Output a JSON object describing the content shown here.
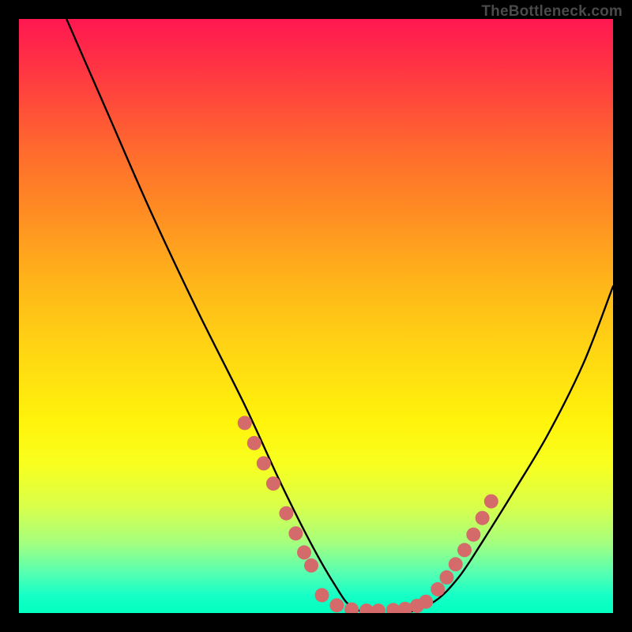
{
  "watermark": "TheBottleneck.com",
  "chart_data": {
    "type": "line",
    "title": "",
    "xlabel": "",
    "ylabel": "",
    "xlim": [
      0,
      100
    ],
    "ylim": [
      0,
      100
    ],
    "grid": false,
    "series": [
      {
        "name": "curve",
        "x": [
          8,
          15,
          22,
          30,
          38,
          44,
          49,
          53,
          56,
          60,
          65,
          70,
          74,
          78,
          83,
          89,
          95,
          100
        ],
        "y": [
          100,
          84,
          68,
          51,
          35,
          22,
          12,
          5,
          1,
          0,
          0,
          2,
          6,
          12,
          20,
          30,
          42,
          55
        ],
        "color": "#000000"
      }
    ],
    "markers": [
      {
        "name": "dots-left",
        "x": [
          38.0,
          39.6,
          41.2,
          42.8,
          45.0,
          46.6,
          48.0,
          49.2
        ],
        "y": [
          32.0,
          28.6,
          25.2,
          21.8,
          16.8,
          13.4,
          10.2,
          8.0
        ],
        "color": "#d46a6a"
      },
      {
        "name": "dots-bottom",
        "x": [
          51.0,
          53.5,
          56.0,
          58.5,
          60.5,
          63.0,
          65.0,
          67.0,
          68.5
        ],
        "y": [
          3.0,
          1.3,
          0.6,
          0.4,
          0.4,
          0.5,
          0.7,
          1.2,
          1.9
        ],
        "color": "#d46a6a"
      },
      {
        "name": "dots-right",
        "x": [
          70.5,
          72.0,
          73.5,
          75.0,
          76.5,
          78.0,
          79.5
        ],
        "y": [
          4.0,
          6.0,
          8.2,
          10.6,
          13.2,
          16.0,
          18.8
        ],
        "color": "#d46a6a"
      }
    ],
    "background_gradient": {
      "from": "#ff1751",
      "to": "#02ffbf"
    }
  }
}
